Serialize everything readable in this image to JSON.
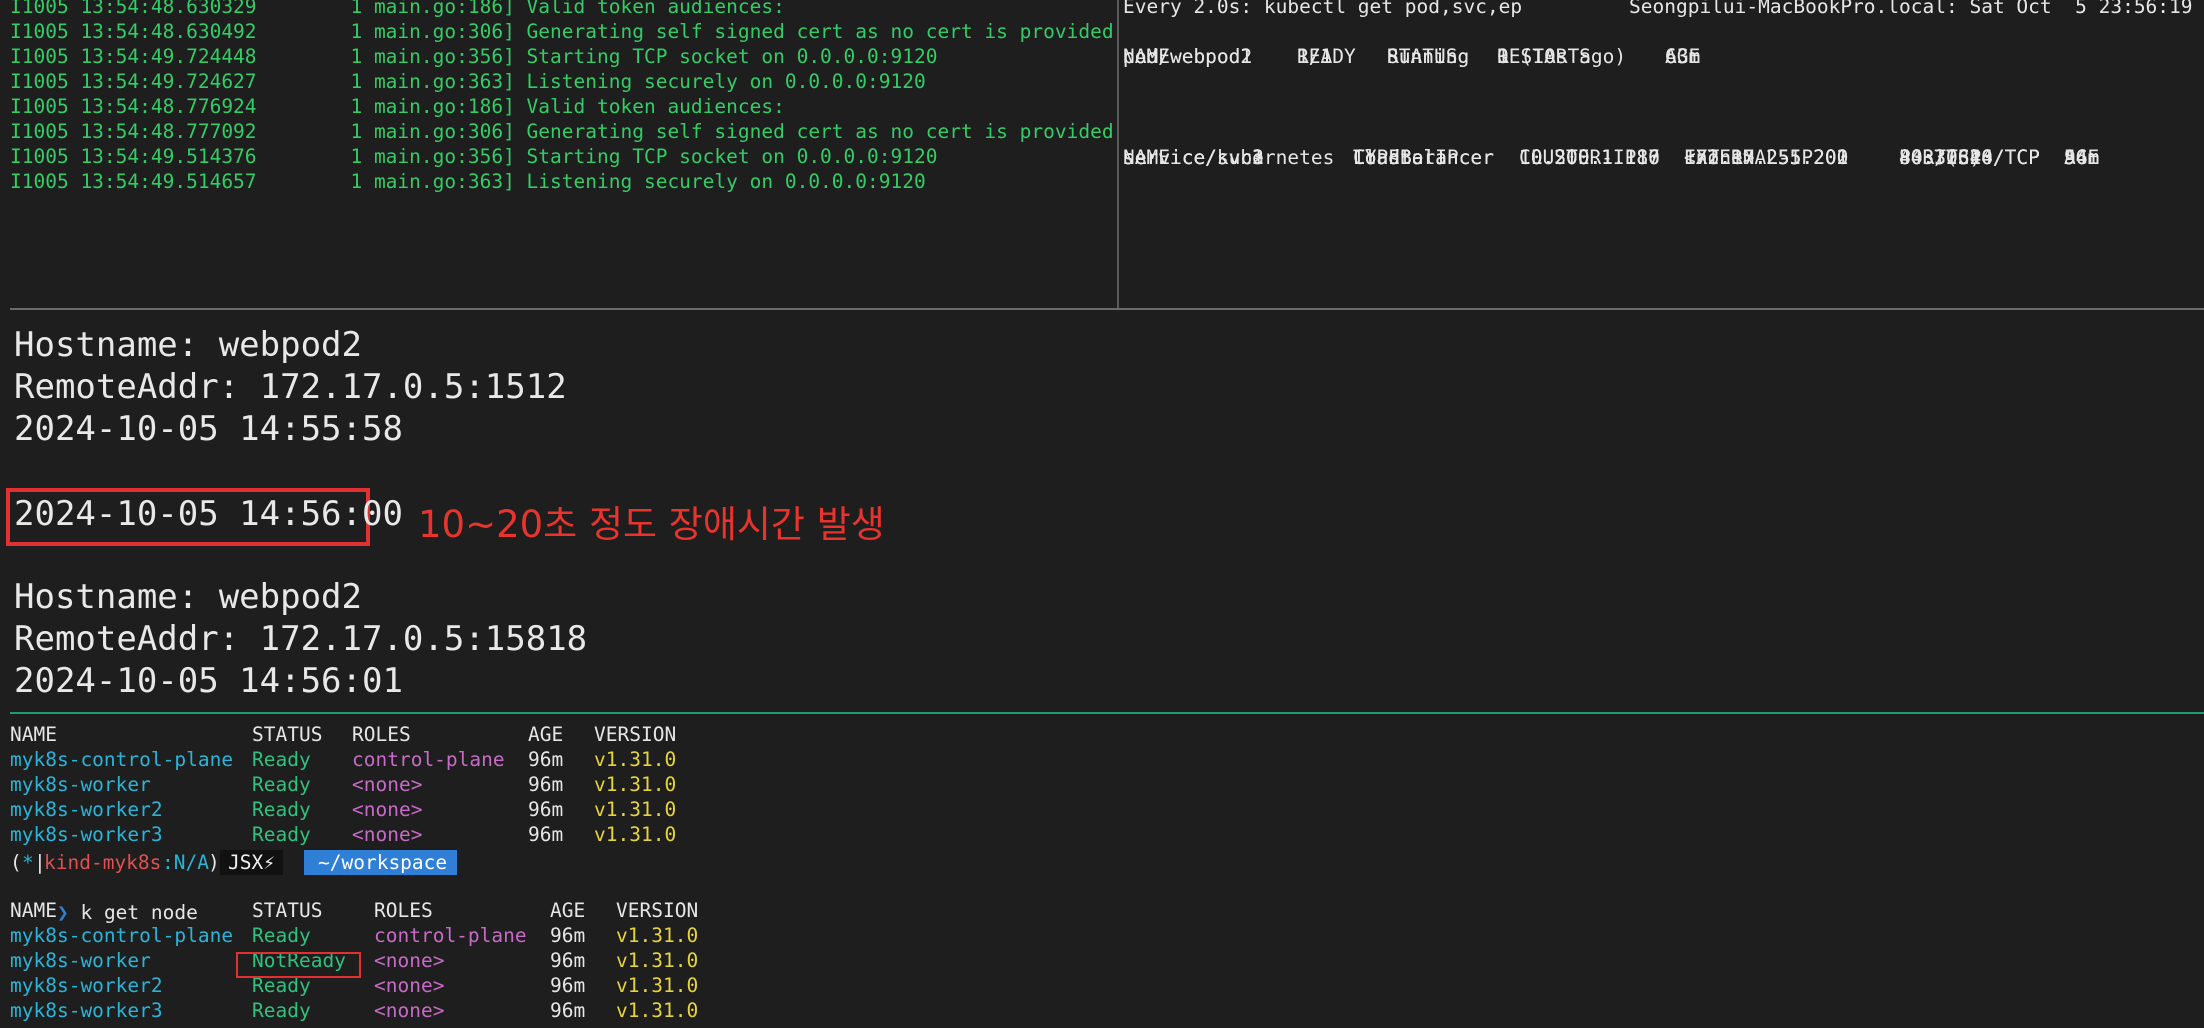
{
  "log_lines": [
    "I1005 13:54:48.630329        1 main.go:186] Valid token audiences:",
    "I1005 13:54:48.630492        1 main.go:306] Generating self signed cert as no cert is provided",
    "I1005 13:54:49.724448        1 main.go:356] Starting TCP socket on 0.0.0.0:9120",
    "I1005 13:54:49.724627        1 main.go:363] Listening securely on 0.0.0.0:9120",
    "I1005 13:54:48.776924        1 main.go:186] Valid token audiences:",
    "I1005 13:54:48.777092        1 main.go:306] Generating self signed cert as no cert is provided",
    "I1005 13:54:49.514376        1 main.go:356] Starting TCP socket on 0.0.0.0:9120",
    "I1005 13:54:49.514657        1 main.go:363] Listening securely on 0.0.0.0:9120"
  ],
  "watch": {
    "header_left": "Every 2.0s: kubectl get pod,svc,ep",
    "header_right": "Seongpilui-MacBookPro.local: Sat Oct  5 23:56:19 2024",
    "pods_header": [
      "NAME",
      "READY",
      "STATUS",
      "RESTARTS",
      "AGE"
    ],
    "pods": [
      [
        "pod/webpod1",
        "1/1",
        "Running",
        "1 (10s ago)",
        "63m"
      ],
      [
        "pod/webpod2",
        "1/1",
        "Running",
        "0",
        "63m"
      ]
    ],
    "svc_header": [
      "NAME",
      "TYPE",
      "CLUSTER-IP",
      "EXTERNAL-IP",
      "PORT(S)",
      "AGE"
    ],
    "svcs": [
      [
        "service/kubernetes",
        "ClusterIP",
        "10.200.1.1",
        "<none>",
        "443/TCP",
        "96m"
      ],
      [
        "service/svc1",
        "LoadBalancer",
        "10.200.1.117",
        "172.17.255.200",
        "80:30614/TCP",
        "54m"
      ],
      [
        "service/svc2",
        "LoadBalancer",
        "10.200.1.180",
        "172.17.255.201",
        "80:32540/TCP",
        "54m"
      ],
      [
        "service/svc3",
        "LoadBalancer",
        "10.200.1.186",
        "172.17.255.202",
        "80:30326/TCP",
        "54m"
      ]
    ]
  },
  "curl_output": {
    "block1": [
      "Hostname: webpod2",
      "RemoteAddr: 172.17.0.5:1512",
      "2024-10-05 14:55:58"
    ],
    "highlighted": "2024-10-05 14:56:00",
    "annotation": "10~20초 정도 장애시간 발생",
    "block2": [
      "Hostname: webpod2",
      "RemoteAddr: 172.17.0.5:15818",
      "2024-10-05 14:56:01"
    ]
  },
  "nodes_header": [
    "NAME",
    "STATUS",
    "ROLES",
    "AGE",
    "VERSION"
  ],
  "nodes_before": [
    [
      "myk8s-control-plane",
      "Ready",
      "control-plane",
      "96m",
      "v1.31.0"
    ],
    [
      "myk8s-worker",
      "Ready",
      "<none>",
      "96m",
      "v1.31.0"
    ],
    [
      "myk8s-worker2",
      "Ready",
      "<none>",
      "96m",
      "v1.31.0"
    ],
    [
      "myk8s-worker3",
      "Ready",
      "<none>",
      "96m",
      "v1.31.0"
    ]
  ],
  "prompt": {
    "open": "(",
    "star": "*",
    "bar": "|",
    "context": "kind-myk8s",
    "ns": ":N/A",
    "close": ")",
    "jsx": "JSX⚡",
    "workspace": "~/workspace",
    "arrow": "❯",
    "command": " k get node"
  },
  "nodes_after": [
    [
      "myk8s-control-plane",
      "Ready",
      "control-plane",
      "96m",
      "v1.31.0"
    ],
    [
      "myk8s-worker",
      "NotReady",
      "<none>",
      "96m",
      "v1.31.0"
    ],
    [
      "myk8s-worker2",
      "Ready",
      "<none>",
      "96m",
      "v1.31.0"
    ],
    [
      "myk8s-worker3",
      "Ready",
      "<none>",
      "96m",
      "v1.31.0"
    ]
  ],
  "colors": {
    "log_green": "#33cc66",
    "node_name": "#2ab4d8",
    "ready": "#2ec27e",
    "role": "#c86ac8",
    "version": "#e6d43b",
    "annotation_red": "#e8342d"
  }
}
